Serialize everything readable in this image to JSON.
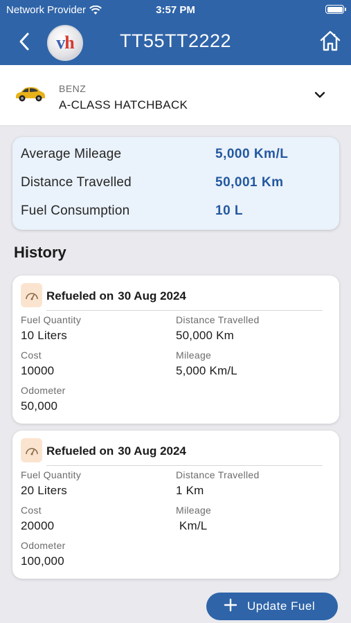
{
  "status_bar": {
    "carrier": "Network Provider",
    "time": "3:57 PM"
  },
  "header": {
    "title": "TT55TT2222",
    "logo_text_v": "v",
    "logo_text_h": "h",
    "back_icon": "chevron-left-icon",
    "home_icon": "home-icon"
  },
  "vehicle": {
    "make": "BENZ",
    "model": "A-CLASS HATCHBACK",
    "image_icon": "car-icon",
    "dropdown_icon": "chevron-down-icon"
  },
  "summary": {
    "rows": [
      {
        "label": "Average Mileage",
        "value": "5,000 Km/L"
      },
      {
        "label": "Distance Travelled",
        "value": "50,001 Km"
      },
      {
        "label": "Fuel Consumption",
        "value": "10 L"
      }
    ]
  },
  "history": {
    "title": "History",
    "entries": [
      {
        "heading": "Refueled on",
        "date": "30 Aug 2024",
        "fuel_quantity_label": "Fuel Quantity",
        "fuel_quantity": "10 Liters",
        "distance_label": "Distance Travelled",
        "distance": "50,000 Km",
        "cost_label": "Cost",
        "cost": "10000",
        "mileage_label": "Mileage",
        "mileage": "5,000 Km/L",
        "odometer_label": "Odometer",
        "odometer": "50,000"
      },
      {
        "heading": "Refueled on",
        "date": "30 Aug 2024",
        "fuel_quantity_label": "Fuel Quantity",
        "fuel_quantity": "20 Liters",
        "distance_label": "Distance Travelled",
        "distance": "1 Km",
        "cost_label": "Cost",
        "cost": "20000",
        "mileage_label": "Mileage",
        "mileage": " Km/L",
        "odometer_label": "Odometer",
        "odometer": "100,000"
      }
    ]
  },
  "actions": {
    "update_fuel_label": "Update Fuel"
  },
  "colors": {
    "primary": "#2f64a8",
    "value_blue": "#2358a0",
    "summary_bg": "#eaf2fb",
    "gauge_bg": "#fbe4cf"
  }
}
